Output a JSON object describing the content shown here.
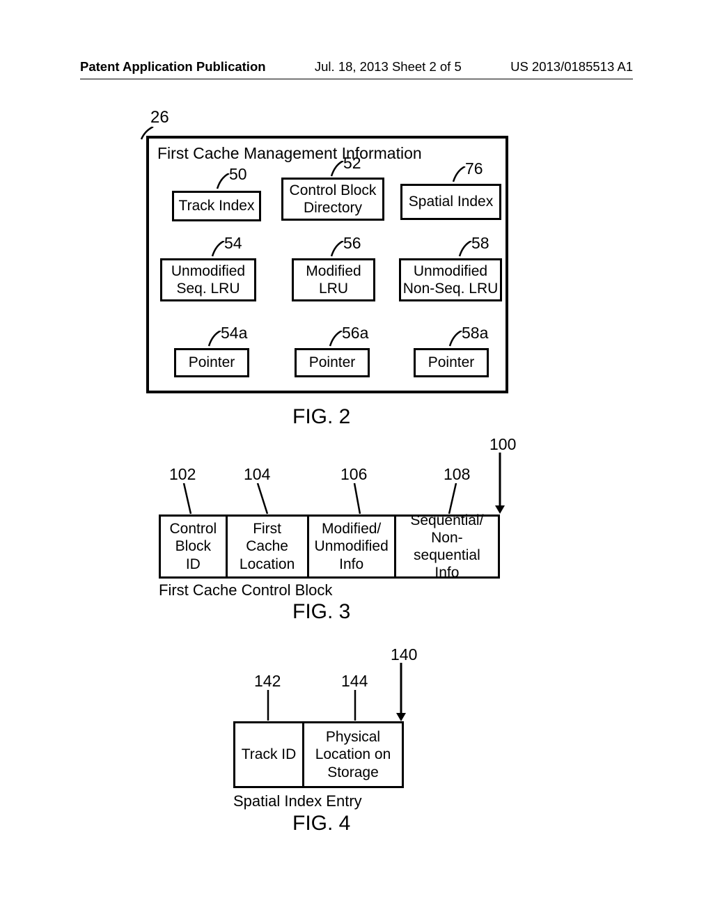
{
  "header": {
    "left": "Patent Application Publication",
    "center": "Jul. 18, 2013   Sheet 2 of 5",
    "right": "US 2013/0185513 A1"
  },
  "fig2": {
    "title": "First Cache Management Information",
    "ref_main": "26",
    "boxes": {
      "b50": {
        "ref": "50",
        "text": "Track Index"
      },
      "b52": {
        "ref": "52",
        "text": "Control Block\nDirectory"
      },
      "b76": {
        "ref": "76",
        "text": "Spatial Index"
      },
      "b54": {
        "ref": "54",
        "text": "Unmodified\nSeq. LRU"
      },
      "b56": {
        "ref": "56",
        "text": "Modified\nLRU"
      },
      "b58": {
        "ref": "58",
        "text": "Unmodified\nNon-Seq. LRU"
      },
      "b54a": {
        "ref": "54a",
        "text": "Pointer"
      },
      "b56a": {
        "ref": "56a",
        "text": "Pointer"
      },
      "b58a": {
        "ref": "58a",
        "text": "Pointer"
      }
    },
    "caption": "FIG. 2"
  },
  "fig3": {
    "ref_main": "100",
    "cells": {
      "c102": {
        "ref": "102",
        "text": "Control\nBlock ID"
      },
      "c104": {
        "ref": "104",
        "text": "First Cache\nLocation"
      },
      "c106": {
        "ref": "106",
        "text": "Modified/\nUnmodified\nInfo"
      },
      "c108": {
        "ref": "108",
        "text": "Sequential/\nNon-sequential\nInfo"
      }
    },
    "subtitle": "First Cache Control Block",
    "caption": "FIG. 3"
  },
  "fig4": {
    "ref_main": "140",
    "cells": {
      "c142": {
        "ref": "142",
        "text": "Track ID"
      },
      "c144": {
        "ref": "144",
        "text": "Physical\nLocation on\nStorage"
      }
    },
    "subtitle": "Spatial Index Entry",
    "caption": "FIG. 4"
  }
}
